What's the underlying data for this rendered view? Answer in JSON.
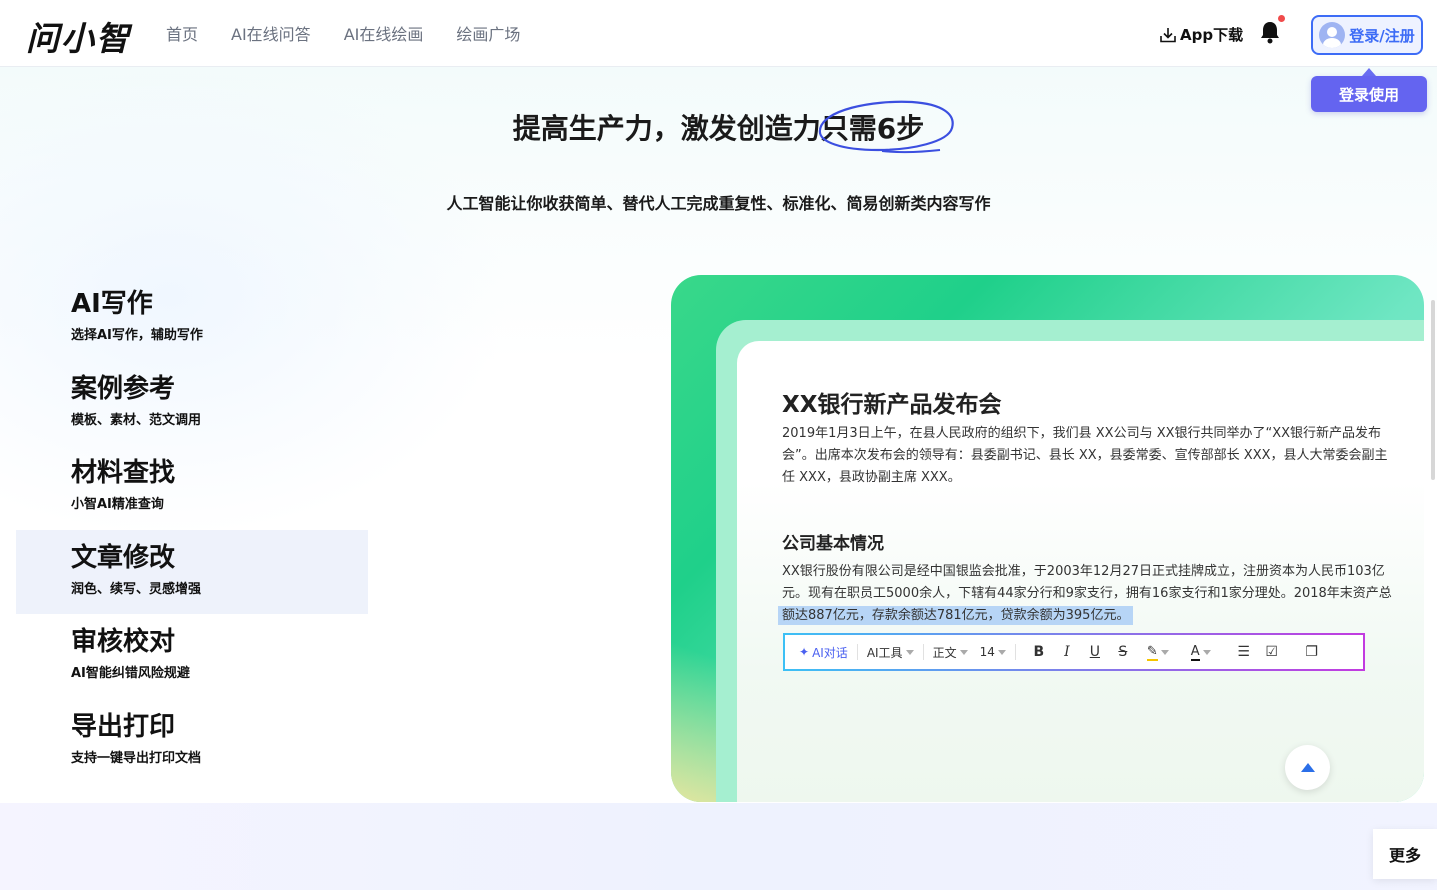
{
  "header": {
    "logo": "问小智",
    "nav": [
      "首页",
      "AI在线问答",
      "AI在线绘画",
      "绘画广场"
    ],
    "app_download": "App下载",
    "login_label": "登录/注册",
    "login_use": "登录使用"
  },
  "hero": {
    "title_prefix": "提高生产力，激发创造力",
    "title_highlight": "只需6步",
    "subtitle": "人工智能让你收获简单、替代人工完成重复性、标准化、简易创新类内容写作"
  },
  "features": [
    {
      "title": "AI写作",
      "desc": "选择AI写作，辅助写作",
      "active": false
    },
    {
      "title": "案例参考",
      "desc": "模板、素材、范文调用",
      "active": false
    },
    {
      "title": "材料查找",
      "desc": "小智AI精准查询",
      "active": false
    },
    {
      "title": "文章修改",
      "desc": "润色、续写、灵感增强",
      "active": true
    },
    {
      "title": "审核校对",
      "desc": "AI智能纠错风险规避",
      "active": false
    },
    {
      "title": "导出打印",
      "desc": "支持一键导出打印文档",
      "active": false
    }
  ],
  "doc": {
    "title": "XX银行新产品发布会",
    "para1": "2019年1月3日上午，在县人民政府的组织下，我们县 XX公司与 XX银行共同举办了“XX银行新产品发布会”。出席本次发布会的领导有：县委副书记、县长 XX，县委常委、宣传部部长 XXX，县人大常委会副主任 XXX，县政协副主席 XXX。",
    "section": "公司基本情况",
    "para2": "XX银行股份有限公司是经中国银监会批准，于2003年12月27日正式挂牌成立，注册资本为人民币103亿元。现有在职员工5000余人，下辖有44家分行和9家支行，拥有16家支行和1家分理处。2018年末资产总",
    "para2_selected": "额达887亿元，存款余额达781亿元，贷款余额为395亿元。"
  },
  "toolbar": {
    "ai_chat": "AI对话",
    "ai_tools": "AI工具",
    "style": "正文",
    "font_size": "14"
  },
  "more": "更多",
  "colors": {
    "accent": "#3d6cf6",
    "login_use_bg": "#6464f0",
    "card_green": "#1fd08a"
  }
}
